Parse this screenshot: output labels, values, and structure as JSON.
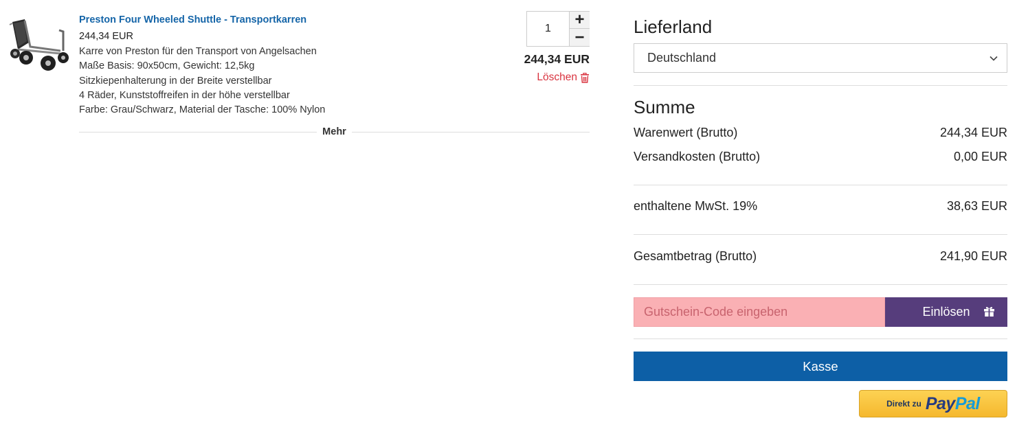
{
  "cart_item": {
    "title": "Preston Four Wheeled Shuttle - Transportkarren",
    "price": "244,34 EUR",
    "description_lines": [
      "Karre von Preston für den Transport von Angelsachen",
      "Maße Basis: 90x50cm, Gewicht: 12,5kg",
      "Sitzkiepenhalterung in der Breite verstellbar",
      "4 Räder, Kunststoffreifen in der höhe verstellbar",
      "Farbe: Grau/Schwarz, Material der Tasche: 100% Nylon"
    ],
    "quantity": "1",
    "plus_label": "+",
    "minus_label": "−",
    "line_total": "244,34 EUR",
    "delete_label": "Löschen",
    "delete_icon": "trash-icon",
    "more_label": "Mehr",
    "image_icon": "cart-trolley-image"
  },
  "shipping": {
    "heading": "Lieferland",
    "selected_country": "Deutschland"
  },
  "summary": {
    "heading": "Summe",
    "goods_label": "Warenwert (Brutto)",
    "goods_value": "244,34 EUR",
    "shipping_label": "Versandkosten (Brutto)",
    "shipping_value": "0,00 EUR",
    "vat_label": "enthaltene MwSt. 19%",
    "vat_value": "38,63 EUR",
    "total_label": "Gesamtbetrag (Brutto)",
    "total_value": "241,90 EUR"
  },
  "coupon": {
    "placeholder": "Gutschein-Code eingeben",
    "button_label": "Einlösen",
    "button_icon": "gift-icon"
  },
  "checkout": {
    "kasse_label": "Kasse",
    "paypal_prefix": "Direkt zu",
    "paypal_pay": "Pay",
    "paypal_pal": "Pal"
  },
  "colors": {
    "link_blue": "#1565a8",
    "delete_red": "#d9333f",
    "coupon_bg": "#fab0b4",
    "redeem_purple": "#563d7c",
    "checkout_blue": "#0d5fa6",
    "paypal_yellow": "#f5b82e"
  }
}
